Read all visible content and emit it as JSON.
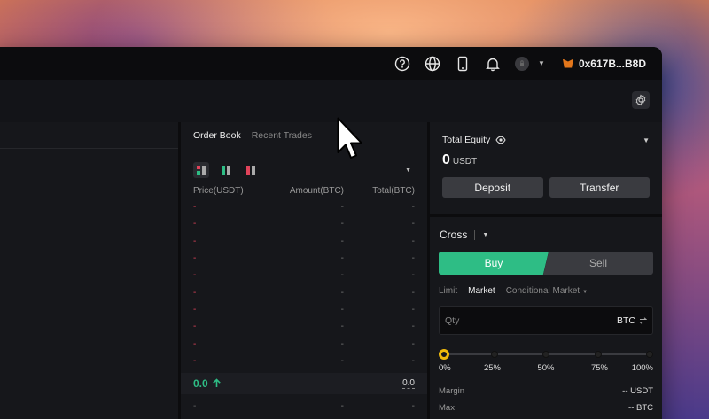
{
  "topbar": {
    "wallet_address": "0x617B...B8D"
  },
  "orderbook": {
    "tabs": [
      "Order Book",
      "Recent Trades"
    ],
    "headers": {
      "price": "Price(USDT)",
      "amount": "Amount(BTC)",
      "total": "Total(BTC)"
    },
    "ask_rows": [
      "-",
      "-",
      "-",
      "-",
      "-",
      "-",
      "-",
      "-",
      "-",
      "-"
    ],
    "last_price": "0.0",
    "mark_price": "0.0",
    "bid_rows": [
      "-",
      "-"
    ]
  },
  "equity": {
    "label": "Total Equity",
    "value": "0",
    "unit": "USDT",
    "deposit_label": "Deposit",
    "transfer_label": "Transfer"
  },
  "trade": {
    "margin_mode": "Cross",
    "buy_label": "Buy",
    "sell_label": "Sell",
    "order_types": [
      "Limit",
      "Market",
      "Conditional Market"
    ],
    "active_order_type": "Market",
    "qty_placeholder": "Qty",
    "qty_unit": "BTC",
    "slider_value": 0,
    "slider_labels": [
      "0%",
      "25%",
      "50%",
      "75%",
      "100%"
    ],
    "margin_label": "Margin",
    "margin_value": "-- USDT",
    "max_label": "Max",
    "max_value": "-- BTC"
  },
  "colors": {
    "buy": "#2ebd85",
    "sell": "#e0435a",
    "accent": "#f0b90b"
  }
}
